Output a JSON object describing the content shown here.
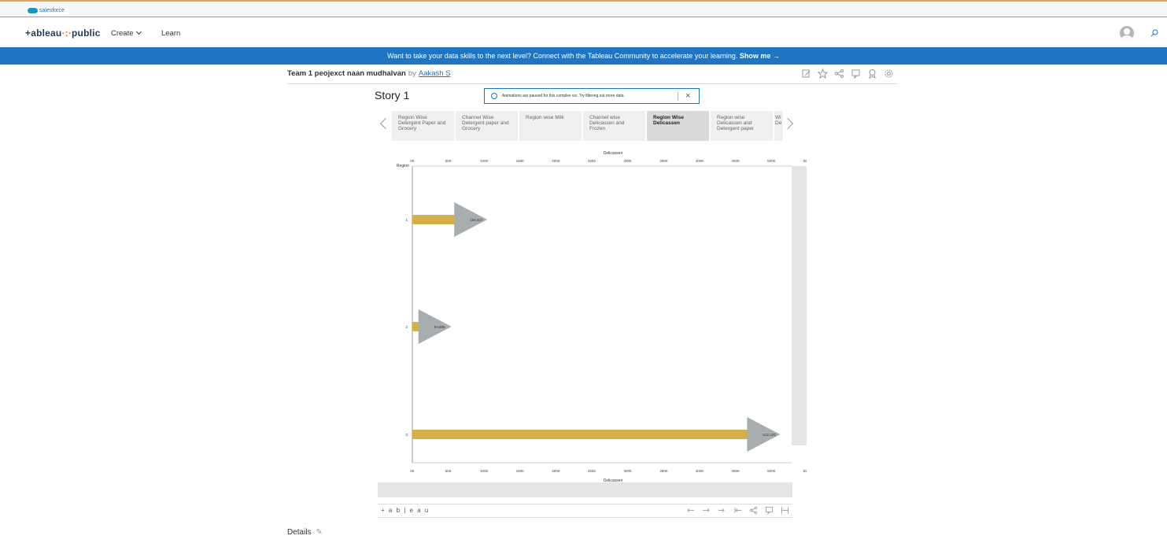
{
  "salesforce_bar": {
    "badge": "salesforce"
  },
  "nav": {
    "logo_a": "+ableau",
    "logo_dots": "·:·",
    "logo_b": "public",
    "create": "Create",
    "learn": "Learn"
  },
  "banner": {
    "text": "Want to take your data skills to the next level? Connect with the Tableau Community to accelerate your learning.",
    "link": "Show me →"
  },
  "viz": {
    "title": "Team 1 peojexct naan mudhalvan",
    "by": "by",
    "author": "Aakash S"
  },
  "story": {
    "title": "Story 1",
    "toast": "Animations are paused for this complex viz. Try filtering out more data.",
    "points": [
      "Region Wise Detergent Paper and Grocery",
      "Channel Wise Detergent paper and Grocery",
      "Region wise Milk",
      "Channel wise Delicassen and Frozen",
      "Region Wise Delicassen",
      "Region wise Delicassen and Detergent paper",
      "Wi De"
    ],
    "active_index": 4
  },
  "toolbar": {
    "logo": "+ a b | e a u"
  },
  "details": "Details",
  "chart_data": {
    "type": "bar",
    "orientation": "horizontal",
    "title": "",
    "xlabel": "Delicassen",
    "ylabel": "Region",
    "x_ticks": [
      "0K",
      "50K",
      "100K",
      "150K",
      "200K",
      "250K",
      "300K",
      "350K",
      "400K",
      "450K",
      "500K",
      "550K"
    ],
    "xlim": [
      0,
      550000
    ],
    "categories": [
      "1",
      "2",
      "3"
    ],
    "values": [
      104327,
      54506,
      512110
    ],
    "data_labels": [
      "104,327",
      "54,506",
      "512,110"
    ],
    "bar_color": "#d4b04a",
    "marker_color": "#a8adb0",
    "marker": "triangle-right"
  }
}
